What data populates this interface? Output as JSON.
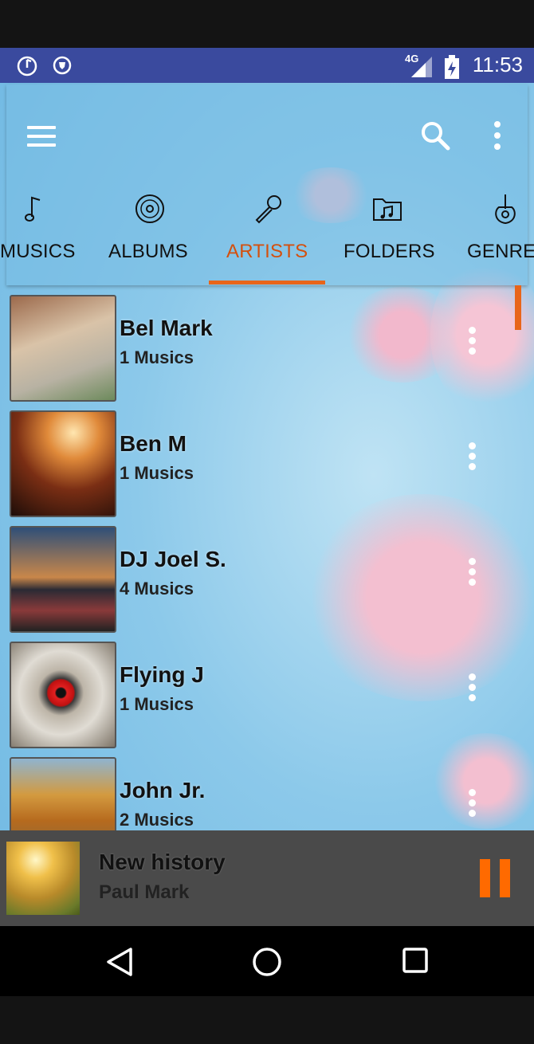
{
  "status_bar": {
    "time": "11:53",
    "network": "4G"
  },
  "toolbar": {
    "menu_icon": "hamburger-menu-icon",
    "search_icon": "search-icon",
    "more_icon": "more-vert-icon"
  },
  "tabs": [
    {
      "label": "MUSICS",
      "icon": "music-note-icon"
    },
    {
      "label": "ALBUMS",
      "icon": "disc-icon"
    },
    {
      "label": "ARTISTS",
      "icon": "microphone-icon",
      "active": true
    },
    {
      "label": "FOLDERS",
      "icon": "music-folder-icon"
    },
    {
      "label": "GENRES",
      "icon": "guitar-icon"
    }
  ],
  "artists": [
    {
      "name": "Bel Mark",
      "count": "1 Musics"
    },
    {
      "name": "Ben M",
      "count": "1 Musics"
    },
    {
      "name": "DJ Joel S.",
      "count": "4 Musics"
    },
    {
      "name": "Flying J",
      "count": "1 Musics"
    },
    {
      "name": "John Jr.",
      "count": "2 Musics"
    }
  ],
  "now_playing": {
    "title": "New history",
    "artist": "Paul Mark",
    "pause_icon": "pause-icon"
  },
  "colors": {
    "accent": "#e8651a",
    "status_bar": "#3a4a9e",
    "player_bg": "#4a4a4a"
  }
}
